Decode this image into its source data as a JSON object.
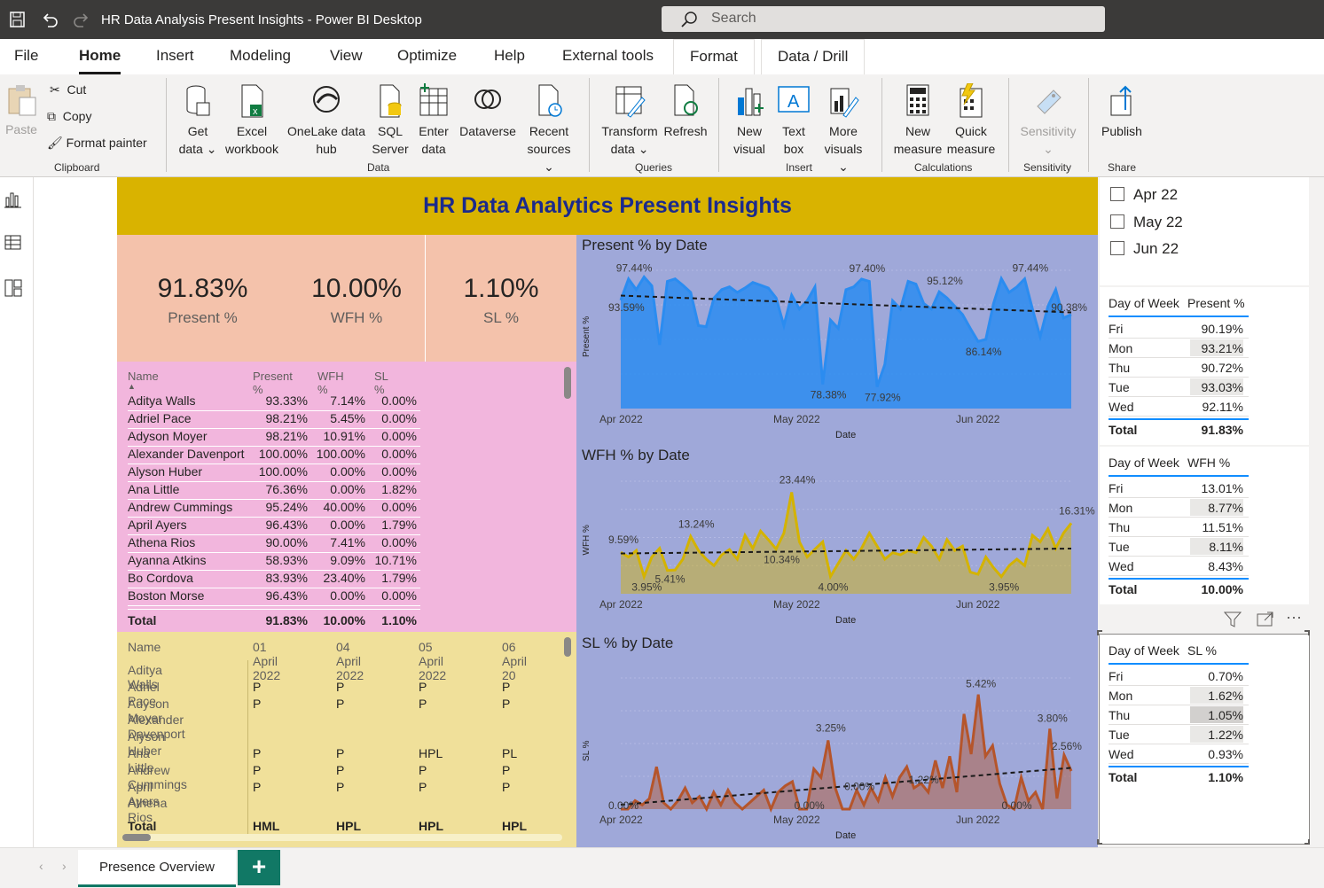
{
  "app": {
    "title": "HR Data Analysis Present Insights - Power BI Desktop",
    "search_placeholder": "Search"
  },
  "menu": [
    "File",
    "Home",
    "Insert",
    "Modeling",
    "View",
    "Optimize",
    "Help",
    "External tools",
    "Format",
    "Data / Drill"
  ],
  "ribbon": {
    "clipboard": {
      "paste": "Paste",
      "cut": "Cut",
      "copy": "Copy",
      "format_painter": "Format painter",
      "group": "Clipboard"
    },
    "data": {
      "get_data": "Get data",
      "excel": "Excel workbook",
      "onelake": "OneLake data hub",
      "sql": "SQL Server",
      "enter_data": "Enter data",
      "dataverse": "Dataverse",
      "recent": "Recent sources",
      "group": "Data"
    },
    "queries": {
      "transform": "Transform data",
      "refresh": "Refresh",
      "group": "Queries"
    },
    "insert": {
      "new_visual": "New visual",
      "text_box": "Text box",
      "more_visuals": "More visuals",
      "group": "Insert"
    },
    "calculations": {
      "new_measure": "New measure",
      "quick_measure": "Quick measure",
      "group": "Calculations"
    },
    "sensitivity": {
      "label": "Sensitivity",
      "group": "Sensitivity"
    },
    "share": {
      "publish": "Publish",
      "group": "Share"
    }
  },
  "report": {
    "title": "HR Data Analytics Present Insights",
    "kpis": [
      {
        "value": "91.83%",
        "label": "Present %"
      },
      {
        "value": "10.00%",
        "label": "WFH %"
      },
      {
        "value": "1.10%",
        "label": "SL %"
      }
    ],
    "table1": {
      "headers": [
        "Name",
        "Present %",
        "WFH %",
        "SL %"
      ],
      "rows": [
        [
          "Aditya Walls",
          "93.33%",
          "7.14%",
          "0.00%"
        ],
        [
          "Adriel Pace",
          "98.21%",
          "5.45%",
          "0.00%"
        ],
        [
          "Adyson Moyer",
          "98.21%",
          "10.91%",
          "0.00%"
        ],
        [
          "Alexander Davenport",
          "100.00%",
          "100.00%",
          "0.00%"
        ],
        [
          "Alyson Huber",
          "100.00%",
          "0.00%",
          "0.00%"
        ],
        [
          "Ana Little",
          "76.36%",
          "0.00%",
          "1.82%"
        ],
        [
          "Andrew Cummings",
          "95.24%",
          "40.00%",
          "0.00%"
        ],
        [
          "April Ayers",
          "96.43%",
          "0.00%",
          "1.79%"
        ],
        [
          "Athena Rios",
          "90.00%",
          "7.41%",
          "0.00%"
        ],
        [
          "Ayanna Atkins",
          "58.93%",
          "9.09%",
          "10.71%"
        ],
        [
          "Bo Cordova",
          "83.93%",
          "23.40%",
          "1.79%"
        ],
        [
          "Boston Morse",
          "96.43%",
          "0.00%",
          "0.00%"
        ]
      ],
      "total": [
        "Total",
        "91.83%",
        "10.00%",
        "1.10%"
      ]
    },
    "table2": {
      "headers": [
        "Name",
        "01 April 2022",
        "04 April 2022",
        "05 April 2022",
        "06 April 20"
      ],
      "rows": [
        [
          "Aditya Walls",
          "",
          "",
          "",
          ""
        ],
        [
          "Adriel Pace",
          "P",
          "P",
          "P",
          "P"
        ],
        [
          "Adyson Moyer",
          "P",
          "P",
          "P",
          "P"
        ],
        [
          "Alexander Davenport",
          "",
          "",
          "",
          ""
        ],
        [
          "Alyson Huber",
          "",
          "",
          "",
          ""
        ],
        [
          "Ana Little",
          "P",
          "P",
          "HPL",
          "PL"
        ],
        [
          "Andrew Cummings",
          "P",
          "P",
          "P",
          "P"
        ],
        [
          "April Ayers",
          "P",
          "P",
          "P",
          "P"
        ],
        [
          "Athena Rios",
          "",
          "",
          "",
          ""
        ]
      ],
      "total": [
        "Total",
        "HML",
        "HPL",
        "HPL",
        "HPL"
      ]
    },
    "slicer": [
      "Apr 22",
      "May 22",
      "Jun 22"
    ],
    "dow_present": {
      "headers": [
        "Day of Week",
        "Present %"
      ],
      "rows": [
        [
          "Fri",
          "90.19%"
        ],
        [
          "Mon",
          "93.21%"
        ],
        [
          "Thu",
          "90.72%"
        ],
        [
          "Tue",
          "93.03%"
        ],
        [
          "Wed",
          "92.11%"
        ]
      ],
      "total": [
        "Total",
        "91.83%"
      ]
    },
    "dow_wfh": {
      "headers": [
        "Day of Week",
        "WFH %"
      ],
      "rows": [
        [
          "Fri",
          "13.01%"
        ],
        [
          "Mon",
          "8.77%"
        ],
        [
          "Thu",
          "11.51%"
        ],
        [
          "Tue",
          "8.11%"
        ],
        [
          "Wed",
          "8.43%"
        ]
      ],
      "total": [
        "Total",
        "10.00%"
      ]
    },
    "dow_sl": {
      "headers": [
        "Day of Week",
        "SL %"
      ],
      "rows": [
        [
          "Fri",
          "0.70%"
        ],
        [
          "Mon",
          "1.62%"
        ],
        [
          "Thu",
          "1.05%"
        ],
        [
          "Tue",
          "1.22%"
        ],
        [
          "Wed",
          "0.93%"
        ]
      ],
      "total": [
        "Total",
        "1.10%"
      ]
    }
  },
  "chart_data": [
    {
      "type": "area",
      "title": "Present % by Date",
      "xlabel": "Date",
      "ylabel": "Present %",
      "x_ticks": [
        "Apr 2022",
        "May 2022",
        "Jun 2022"
      ],
      "color": "#2b8cf0",
      "values": [
        93.59,
        97.44,
        95.5,
        97.8,
        96.2,
        85.5,
        97.0,
        97.44,
        96.3,
        95.0,
        89.0,
        88.8,
        94.0,
        95.5,
        96.0,
        95.0,
        95.8,
        96.8,
        96.3,
        95.8,
        94.0,
        89.0,
        94.5,
        92.0,
        93.5,
        96.0,
        78.38,
        90.0,
        88.5,
        95.5,
        96.0,
        97.4,
        97.0,
        77.92,
        82.0,
        93.5,
        92.0,
        97.0,
        96.5,
        93.0,
        92.0,
        95.12,
        94.0,
        92.5,
        91.0,
        88.5,
        86.14,
        86.5,
        93.0,
        97.5,
        95.0,
        96.0,
        97.44,
        92.0,
        87.0,
        92.5,
        95.5,
        90.38,
        91.0
      ],
      "labels": [
        "97.44%",
        "93.59%",
        "78.38%",
        "97.40%",
        "77.92%",
        "95.12%",
        "86.14%",
        "97.44%",
        "90.38%"
      ]
    },
    {
      "type": "area",
      "title": "WFH % by Date",
      "xlabel": "Date",
      "ylabel": "WFH %",
      "x_ticks": [
        "Apr 2022",
        "May 2022",
        "Jun 2022"
      ],
      "color": "#d4b300",
      "values": [
        9.59,
        8.5,
        10.0,
        3.95,
        8.5,
        10.5,
        5.41,
        5.5,
        8.0,
        13.24,
        10.0,
        8.0,
        6.5,
        9.0,
        10.2,
        8.0,
        13.5,
        10.5,
        14.5,
        12.5,
        10.34,
        14.0,
        23.44,
        12.0,
        8.5,
        10.3,
        12.0,
        4.0,
        7.0,
        10.0,
        8.0,
        10.5,
        14.0,
        11.0,
        8.0,
        9.5,
        9.0,
        10.0,
        9.5,
        13.0,
        11.0,
        8.0,
        12.5,
        10.0,
        11.0,
        5.0,
        4.5,
        8.5,
        6.0,
        3.95,
        6.5,
        8.0,
        6.5,
        13.5,
        12.0,
        15.0,
        10.5,
        14.0,
        16.31
      ],
      "labels": [
        "9.59%",
        "13.24%",
        "3.95%",
        "5.41%",
        "23.44%",
        "10.34%",
        "4.00%",
        "3.95%",
        "16.31%"
      ]
    },
    {
      "type": "area",
      "title": "SL % by Date",
      "xlabel": "Date",
      "ylabel": "SL %",
      "x_ticks": [
        "Apr 2022",
        "May 2022",
        "Jun 2022"
      ],
      "color": "#b5552b",
      "values": [
        0.0,
        0.0,
        0.4,
        0.2,
        0.5,
        2.0,
        0.3,
        0.0,
        0.4,
        1.0,
        0.3,
        0.6,
        0.0,
        0.8,
        0.2,
        0.9,
        0.3,
        0.0,
        0.3,
        0.6,
        0.9,
        0.0,
        0.8,
        1.1,
        1.3,
        0.0,
        0.0,
        1.9,
        1.5,
        3.25,
        1.0,
        0.0,
        0.0,
        0.9,
        0.2,
        1.0,
        0.4,
        1.5,
        0.6,
        1.5,
        2.0,
        1.0,
        1.22,
        0.8,
        2.3,
        1.0,
        2.5,
        0.8,
        4.5,
        2.6,
        5.42,
        2.5,
        3.0,
        1.2,
        0.2,
        0.0,
        1.5,
        0.4,
        0.8,
        0.0,
        3.8,
        0.5,
        2.56,
        1.8
      ],
      "labels": [
        "0.00%",
        "3.25%",
        "0.00%",
        "0.00%",
        "1.22%",
        "5.42%",
        "0.00%",
        "3.80%",
        "2.56%"
      ]
    }
  ],
  "pages": {
    "current": "Presence Overview",
    "add": "+"
  }
}
